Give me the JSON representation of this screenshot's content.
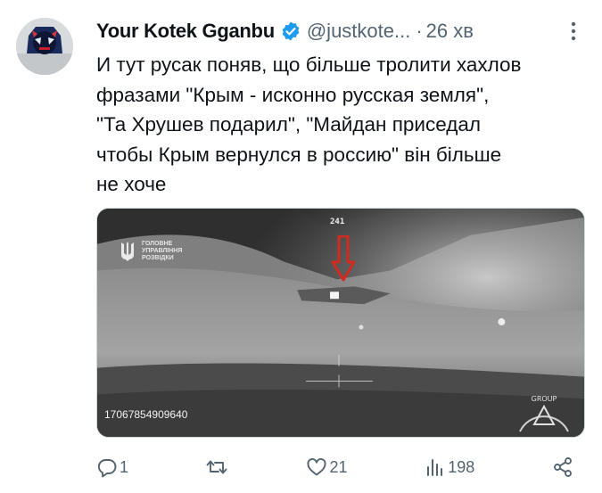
{
  "tweet": {
    "display_name": "Your Kotek Gganbu",
    "handle": "@justkote...",
    "separator": "·",
    "time": "26 хв",
    "text": "И тут русак поняв, що більше тролити хахлов\nфразами \"Крым - исконно русская земля\",\n\"Та Хрушев подарил\", \"Майдан приседал\nчтобы Крым вернулся в россию\" він більше\nне хоче"
  },
  "media": {
    "hud_count": "241",
    "watermark_lines": "ГОЛОВНЕ\nУПРАВЛІННЯ\nРОЗВІДКИ",
    "video_id": "17067854909640",
    "logo_text": "GROUP"
  },
  "actions": {
    "replies": "1",
    "retweets": "",
    "likes": "21",
    "views": "198"
  },
  "colors": {
    "text": "#0f1419",
    "secondary": "#536471",
    "verified": "#1d9bf0",
    "arrow": "#d22a1e"
  },
  "icons": [
    "verified-badge-icon",
    "more-icon",
    "reply-icon",
    "retweet-icon",
    "like-icon",
    "views-icon",
    "share-icon"
  ]
}
